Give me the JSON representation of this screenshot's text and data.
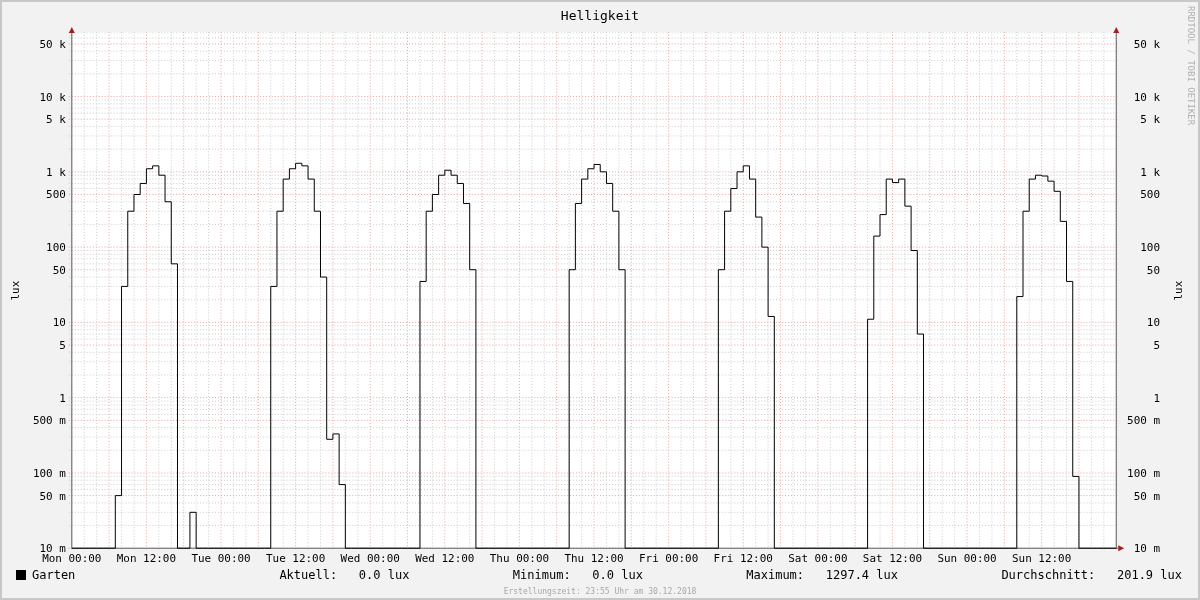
{
  "title": "Helligkeit",
  "watermark": "RRDTOOL / TOBI OETIKER",
  "graph": {
    "y_axis_title": "lux",
    "x_axis_labels": [
      "Mon 00:00",
      "Mon 12:00",
      "Tue 00:00",
      "Tue 12:00",
      "Wed 00:00",
      "Wed 12:00",
      "Thu 00:00",
      "Thu 12:00",
      "Fri 00:00",
      "Fri 12:00",
      "Sat 00:00",
      "Sat 12:00",
      "Sun 00:00",
      "Sun 12:00"
    ],
    "y_axis_labels": [
      "50 k",
      "10 k",
      "5 k",
      "1 k",
      "500",
      "100",
      "50",
      "10",
      "5",
      "1",
      "500 m",
      "100 m",
      "50 m",
      "10 m"
    ],
    "right_axis": {
      "title": "lux",
      "labels": [
        "50 k",
        "10 k",
        "5 k",
        "1 k",
        "500",
        "100",
        "50",
        "10",
        "5",
        "1",
        "500 m",
        "100 m",
        "50 m",
        "10 m"
      ]
    }
  },
  "legend": {
    "name": "Garten",
    "color": "#000000"
  },
  "stats": [
    {
      "label": "Aktuell:",
      "value": "0.0 lux"
    },
    {
      "label": "Minimum:",
      "value": "0.0 lux"
    },
    {
      "label": "Maximum:",
      "value": "1297.4 lux"
    },
    {
      "label": "Durchschnitt:",
      "value": "201.9 lux"
    }
  ],
  "footer": "Erstellungszeit: 23:55 Uhr am 30.12.2018"
}
